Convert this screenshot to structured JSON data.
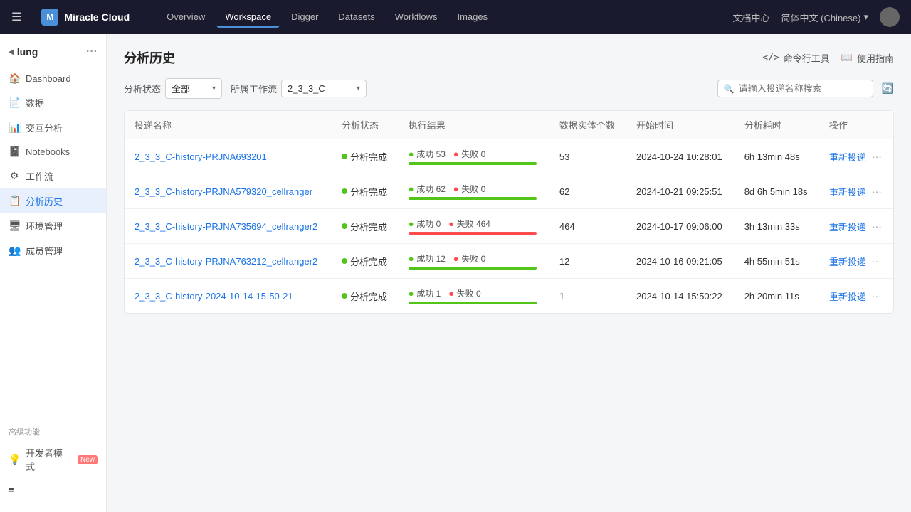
{
  "topnav": {
    "logo": "Miracle Cloud",
    "hamburger": "☰",
    "links": [
      {
        "label": "Overview",
        "active": false
      },
      {
        "label": "Workspace",
        "active": true
      },
      {
        "label": "Digger",
        "active": false
      },
      {
        "label": "Datasets",
        "active": false
      },
      {
        "label": "Workflows",
        "active": false
      },
      {
        "label": "Images",
        "active": false
      }
    ],
    "doc_center": "文档中心",
    "lang": "简体中文 (Chinese)",
    "lang_arrow": "▾"
  },
  "sidebar": {
    "workspace_label": "lung",
    "items": [
      {
        "label": "Dashboard",
        "icon": "🏠",
        "id": "dashboard",
        "active": false
      },
      {
        "label": "数据",
        "icon": "📄",
        "id": "data",
        "active": false
      },
      {
        "label": "交互分析",
        "icon": "📊",
        "id": "interactive",
        "active": false
      },
      {
        "label": "Notebooks",
        "icon": "📓",
        "id": "notebooks",
        "active": false
      },
      {
        "label": "工作流",
        "icon": "⚙",
        "id": "workflow",
        "active": false
      },
      {
        "label": "分析历史",
        "icon": "📋",
        "id": "history",
        "active": true
      },
      {
        "label": "环境管理",
        "icon": "🖥",
        "id": "env",
        "active": false
      },
      {
        "label": "成员管理",
        "icon": "👥",
        "id": "members",
        "active": false
      }
    ],
    "advanced_label": "高级功能",
    "dev_mode_label": "开发者模式",
    "dev_mode_badge": "New",
    "collapse_icon": "≡"
  },
  "page": {
    "title": "分析历史",
    "actions": [
      {
        "label": "命令行工具",
        "icon": "</>",
        "id": "cli"
      },
      {
        "label": "使用指南",
        "icon": "📖",
        "id": "guide"
      }
    ]
  },
  "filters": {
    "status_label": "分析状态",
    "status_value": "全部",
    "workflow_label": "所属工作流",
    "workflow_value": "2_3_3_C",
    "search_placeholder": "请输入投递名称搜索"
  },
  "table": {
    "columns": [
      "投递名称",
      "分析状态",
      "执行结果",
      "数据实体个数",
      "开始时间",
      "分析耗时",
      "操作"
    ],
    "rows": [
      {
        "name": "2_3_3_C-history-PRJNA693201",
        "status": "分析完成",
        "success": 53,
        "fail": 0,
        "total": 53,
        "start_time": "2024-10-24 10:28:01",
        "duration": "6h 13min 48s",
        "action": "重新投递"
      },
      {
        "name": "2_3_3_C-history-PRJNA579320_cellranger",
        "status": "分析完成",
        "success": 62,
        "fail": 0,
        "total": 62,
        "start_time": "2024-10-21 09:25:51",
        "duration": "8d 6h 5min 18s",
        "action": "重新投递"
      },
      {
        "name": "2_3_3_C-history-PRJNA735694_cellranger2",
        "status": "分析完成",
        "success": 0,
        "fail": 464,
        "total": 464,
        "start_time": "2024-10-17 09:06:00",
        "duration": "3h 13min 33s",
        "action": "重新投递"
      },
      {
        "name": "2_3_3_C-history-PRJNA763212_cellranger2",
        "status": "分析完成",
        "success": 12,
        "fail": 0,
        "total": 12,
        "start_time": "2024-10-16 09:21:05",
        "duration": "4h 55min 51s",
        "action": "重新投递"
      },
      {
        "name": "2_3_3_C-history-2024-10-14-15-50-21",
        "status": "分析完成",
        "success": 1,
        "fail": 0,
        "total": 1,
        "start_time": "2024-10-14 15:50:22",
        "duration": "2h 20min 11s",
        "action": "重新投递"
      }
    ]
  }
}
